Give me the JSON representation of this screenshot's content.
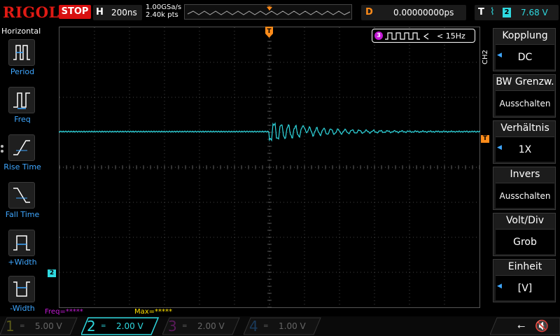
{
  "header": {
    "brand": "RIGOL",
    "run_state": "STOP",
    "timebase_key": "H",
    "timebase_value": "200ns",
    "sample_rate": "1.00GSa/s",
    "memory_depth": "2.40k pts",
    "trigger_pos_marker": "T",
    "delay_key": "D",
    "delay_value": "0.00000000ps",
    "trigger_key": "T",
    "trigger_edge": "⌇",
    "trigger_source": "2",
    "trigger_level": "7.68 V"
  },
  "left_panel": {
    "title": "Horizontal",
    "items": [
      {
        "label": "Period",
        "icon": "period-icon"
      },
      {
        "label": "Freq",
        "icon": "freq-icon"
      },
      {
        "label": "Rise Time",
        "icon": "rise-time-icon"
      },
      {
        "label": "Fall Time",
        "icon": "fall-time-icon"
      },
      {
        "label": "+Width",
        "icon": "positive-width-icon"
      },
      {
        "label": "-Width",
        "icon": "negative-width-icon"
      }
    ]
  },
  "screen": {
    "trigger_marker": "T",
    "channel_marker": "2",
    "trigger_level_marker": "T",
    "freq_counter_channel": "3",
    "freq_counter_value": "< 15Hz",
    "freq_readout": "Freq=*****",
    "max_readout": "Max=*****"
  },
  "right_panel": {
    "channel": "CH2",
    "items": [
      {
        "title": "Kopplung",
        "value": "DC"
      },
      {
        "title": "BW Grenzw.",
        "value": "Ausschalten"
      },
      {
        "title": "Verhältnis",
        "value": "1X"
      },
      {
        "title": "Invers",
        "value": "Ausschalten"
      },
      {
        "title": "Volt/Div",
        "value": "Grob"
      },
      {
        "title": "Einheit",
        "value": "[V]"
      }
    ]
  },
  "channels": [
    {
      "num": "1",
      "coupling": "=",
      "scale": "5.00 V",
      "active": false,
      "color": "#5a5a1a"
    },
    {
      "num": "2",
      "coupling": "=",
      "scale": "2.00 V",
      "active": true,
      "color": "#2fd9e0"
    },
    {
      "num": "3",
      "coupling": "=",
      "scale": "2.00 V",
      "active": false,
      "color": "#5a1a5a"
    },
    {
      "num": "4",
      "coupling": "=",
      "scale": "1.00 V",
      "active": false,
      "color": "#1a3a5a"
    }
  ],
  "status_icons": {
    "usb": "usb-icon",
    "sound": "speaker-mute-icon"
  },
  "colors": {
    "accent_red": "#e01a14",
    "ch2": "#2fd9e0",
    "trigger": "#ff8c1a",
    "ch3": "#c41ad6",
    "label_blue": "#3fa7ff",
    "max_yellow": "#ffe200"
  }
}
